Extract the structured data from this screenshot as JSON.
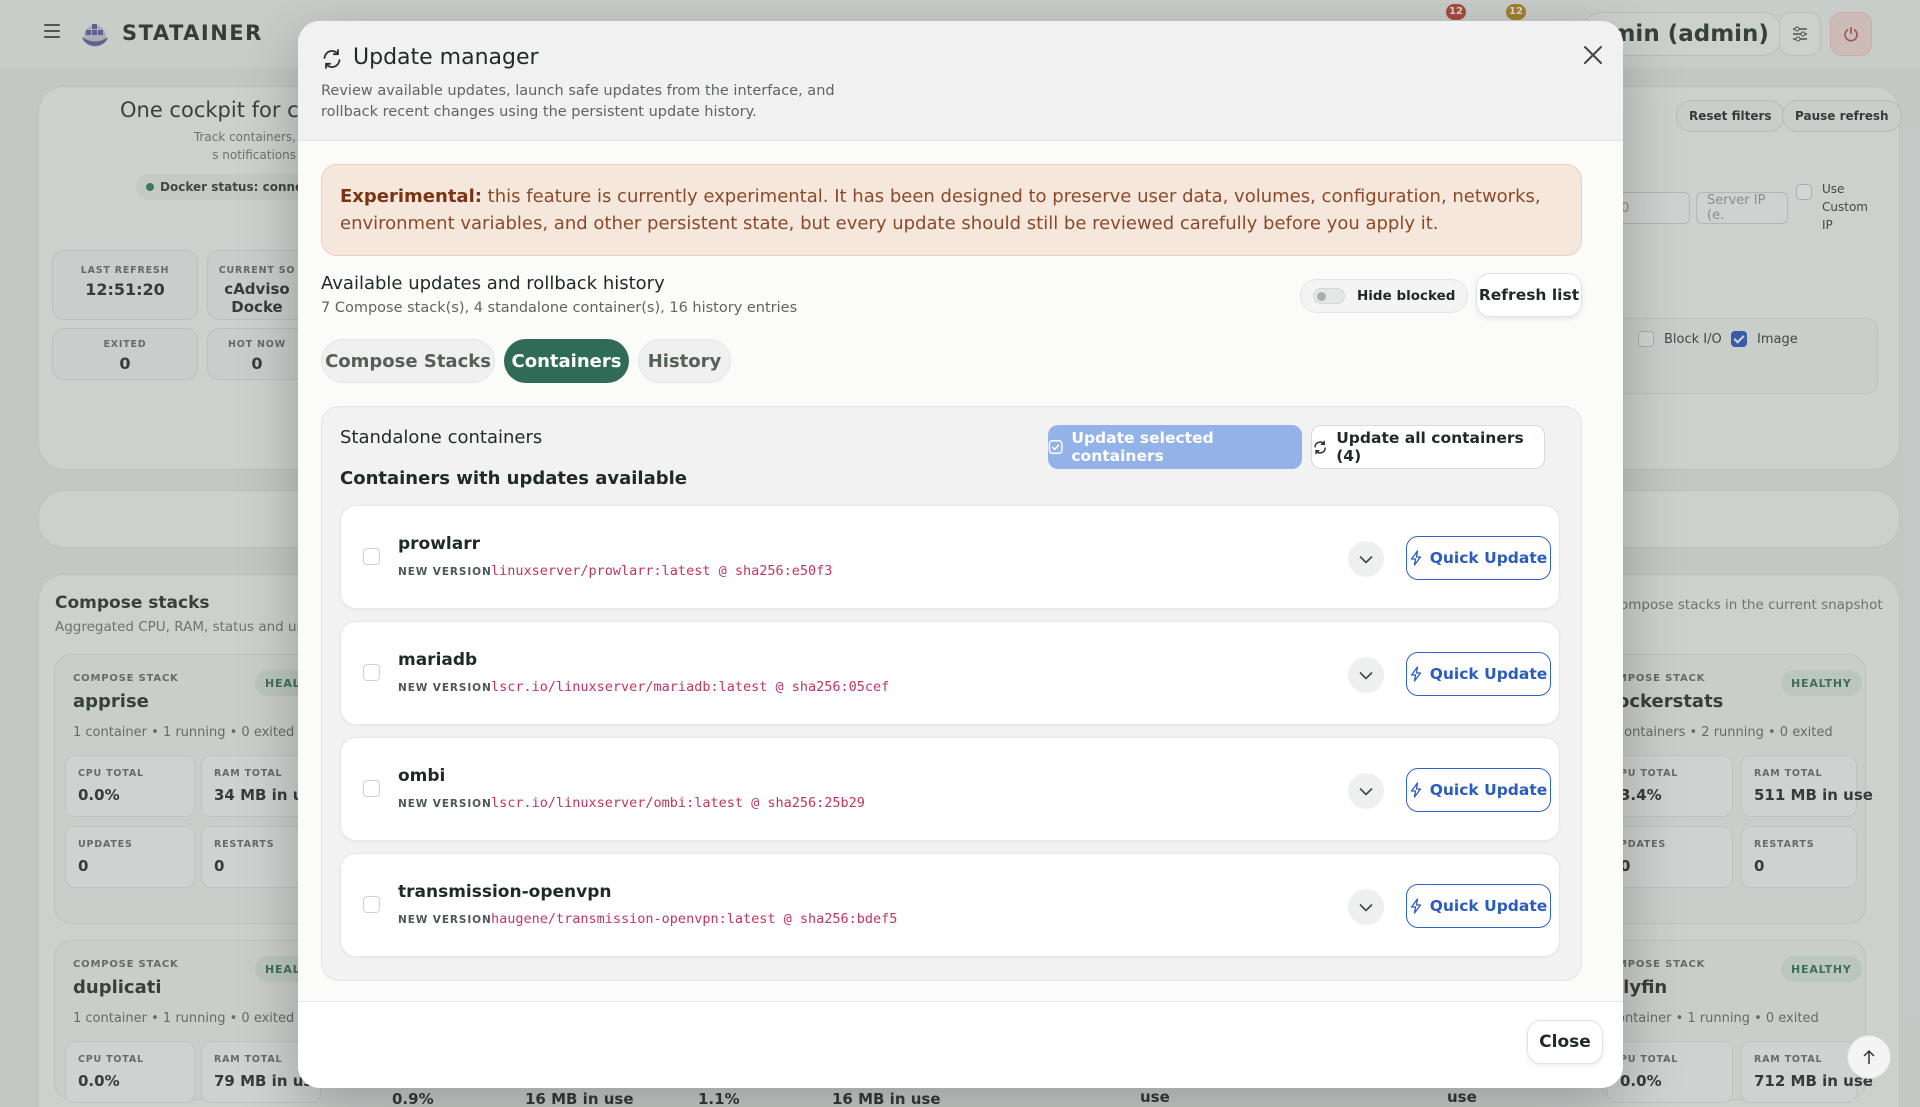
{
  "app": {
    "brand": "STATAINER",
    "notifications": [
      "12",
      "12"
    ],
    "user_label": "admin (admin)",
    "user_label_visible": "dmin (admin)"
  },
  "background": {
    "hero_title": "One cockpit for co",
    "hero_sub": "Track containers, s notifications",
    "docker_status": "Docker status: conne",
    "stats": [
      {
        "label": "LAST REFRESH",
        "value": "12:51:20"
      },
      {
        "label": "CURRENT SO",
        "value": "cAdviso Docke"
      },
      {
        "label": "EXITED",
        "value": "0"
      },
      {
        "label": "HOT NOW",
        "value": "0"
      }
    ],
    "reset_filters": "Reset filters",
    "pause_refresh": "Pause refresh",
    "server_ip_placeholder": "Server IP (e.",
    "ip_fragment": "0",
    "use_custom_ip": "Use Custom IP",
    "block_io": "Block I/O",
    "image": "Image",
    "compose_title": "Compose stacks",
    "compose_sub": "Aggregated CPU, RAM, status and up",
    "compose_sub_right": "ompose stacks in the current snapshot",
    "stacks": [
      {
        "tag": "COMPOSE STACK",
        "name": "apprise",
        "health": "HEALT",
        "meta": "1 container • 1 running • 0 exited",
        "cpu": "0.0%",
        "ram": "34 MB in us",
        "updates": "0",
        "restarts": "0"
      },
      {
        "tag": "MPOSE STACK",
        "name": "ockerstats",
        "health": "HEALTHY",
        "meta": "containers • 2 running • 0 exited",
        "cpu": "3.4%",
        "ram": "511 MB in use",
        "updates": "0",
        "restarts": "0"
      },
      {
        "tag": "COMPOSE STACK",
        "name": "duplicati",
        "health": "HEALT",
        "meta": "1 container • 1 running • 0 exited",
        "cpu": "0.0%",
        "ram": "79 MB in us"
      },
      {
        "tag": "MPOSE STACK",
        "name": "llyfin",
        "health": "HEALTHY",
        "meta": "ontainer • 1 running • 0 exited",
        "cpu": "0.0%",
        "ram": "712 MB in use"
      }
    ],
    "stack_labels": {
      "cpu": "CPU TOTAL",
      "cpu_cut": "PU TOTAL",
      "ram": "RAM TOTAL",
      "updates": "UPDATES",
      "updates_cut": "PDATES",
      "restarts": "RESTARTS"
    },
    "bottom_values": [
      "0.9%",
      "16 MB in use",
      "1.1%",
      "16 MB in use",
      "use",
      "use"
    ]
  },
  "modal": {
    "title": "Update manager",
    "description": "Review available updates, launch safe updates from the interface, and rollback recent changes using the persistent update history.",
    "warning_label": "Experimental:",
    "warning_text": " this feature is currently experimental. It has been designed to preserve user data, volumes, configuration, networks, environment variables, and other persistent state, but every update should still be reviewed carefully before you apply it.",
    "list_title": "Available updates and rollback history",
    "list_sub": "7 Compose stack(s), 4 standalone container(s), 16 history entries",
    "hide_blocked": "Hide blocked",
    "refresh_list": "Refresh list",
    "tabs": [
      {
        "label": "Compose Stacks",
        "active": false
      },
      {
        "label": "Containers",
        "active": true
      },
      {
        "label": "History",
        "active": false
      }
    ],
    "panel_title": "Standalone containers",
    "panel_sub": "Containers with updates available",
    "update_selected": "Update selected containers",
    "update_all": "Update all containers (4)",
    "new_version_label": "NEW VERSION",
    "quick_update": "Quick Update",
    "containers": [
      {
        "name": "prowlarr",
        "image": "linuxserver/prowlarr:latest @ sha256:e50f3"
      },
      {
        "name": "mariadb",
        "image": "lscr.io/linuxserver/mariadb:latest @ sha256:05cef"
      },
      {
        "name": "ombi",
        "image": "lscr.io/linuxserver/ombi:latest @ sha256:25b29"
      },
      {
        "name": "transmission-openvpn",
        "image": "haugene/transmission-openvpn:latest @ sha256:bdef5"
      }
    ],
    "close": "Close"
  },
  "colors": {
    "primary": "#2f6b57",
    "link_blue": "#2a5bbf",
    "warn_bg": "#f6e7dc",
    "image_text": "#c2355f"
  }
}
